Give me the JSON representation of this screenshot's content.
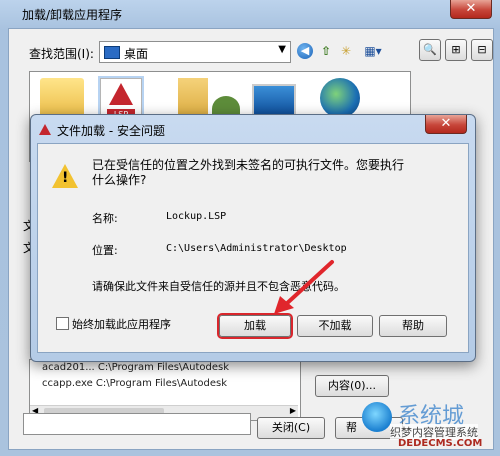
{
  "bg_window": {
    "title": "加载/卸载应用程序",
    "lookin_label": "查找范围(I):",
    "lookin_value": "桌面",
    "left_letters": [
      "文",
      "文"
    ],
    "file_rows": [
      "acad201...   C:\\Program Files\\Autodesk",
      "ccapp.exe    C:\\Program Files\\Autodesk"
    ],
    "content_button": "内容(0)...",
    "close_button": "关闭(C)",
    "help_button": "帮"
  },
  "dialog": {
    "title": "文件加载 - 安全问题",
    "question": "已在受信任的位置之外找到未签名的可执行文件。您要执行什么操作?",
    "name_label": "名称:",
    "name_value": "Lockup.LSP",
    "location_label": "位置:",
    "location_value": "C:\\Users\\Administrator\\Desktop",
    "warning": "请确保此文件来自受信任的源并且不包含恶意代码。",
    "checkbox_label": "始终加载此应用程序",
    "load_button": "加载",
    "noload_button": "不加载",
    "help_button": "帮助"
  },
  "watermark": {
    "line1": "系统城",
    "line2": "织梦内容管理系统",
    "line3": "DEDECMS.COM"
  },
  "icons": {
    "lsp_label": "LSP"
  },
  "colors": {
    "highlight": "#d9262c",
    "warning": "#f2c230"
  }
}
